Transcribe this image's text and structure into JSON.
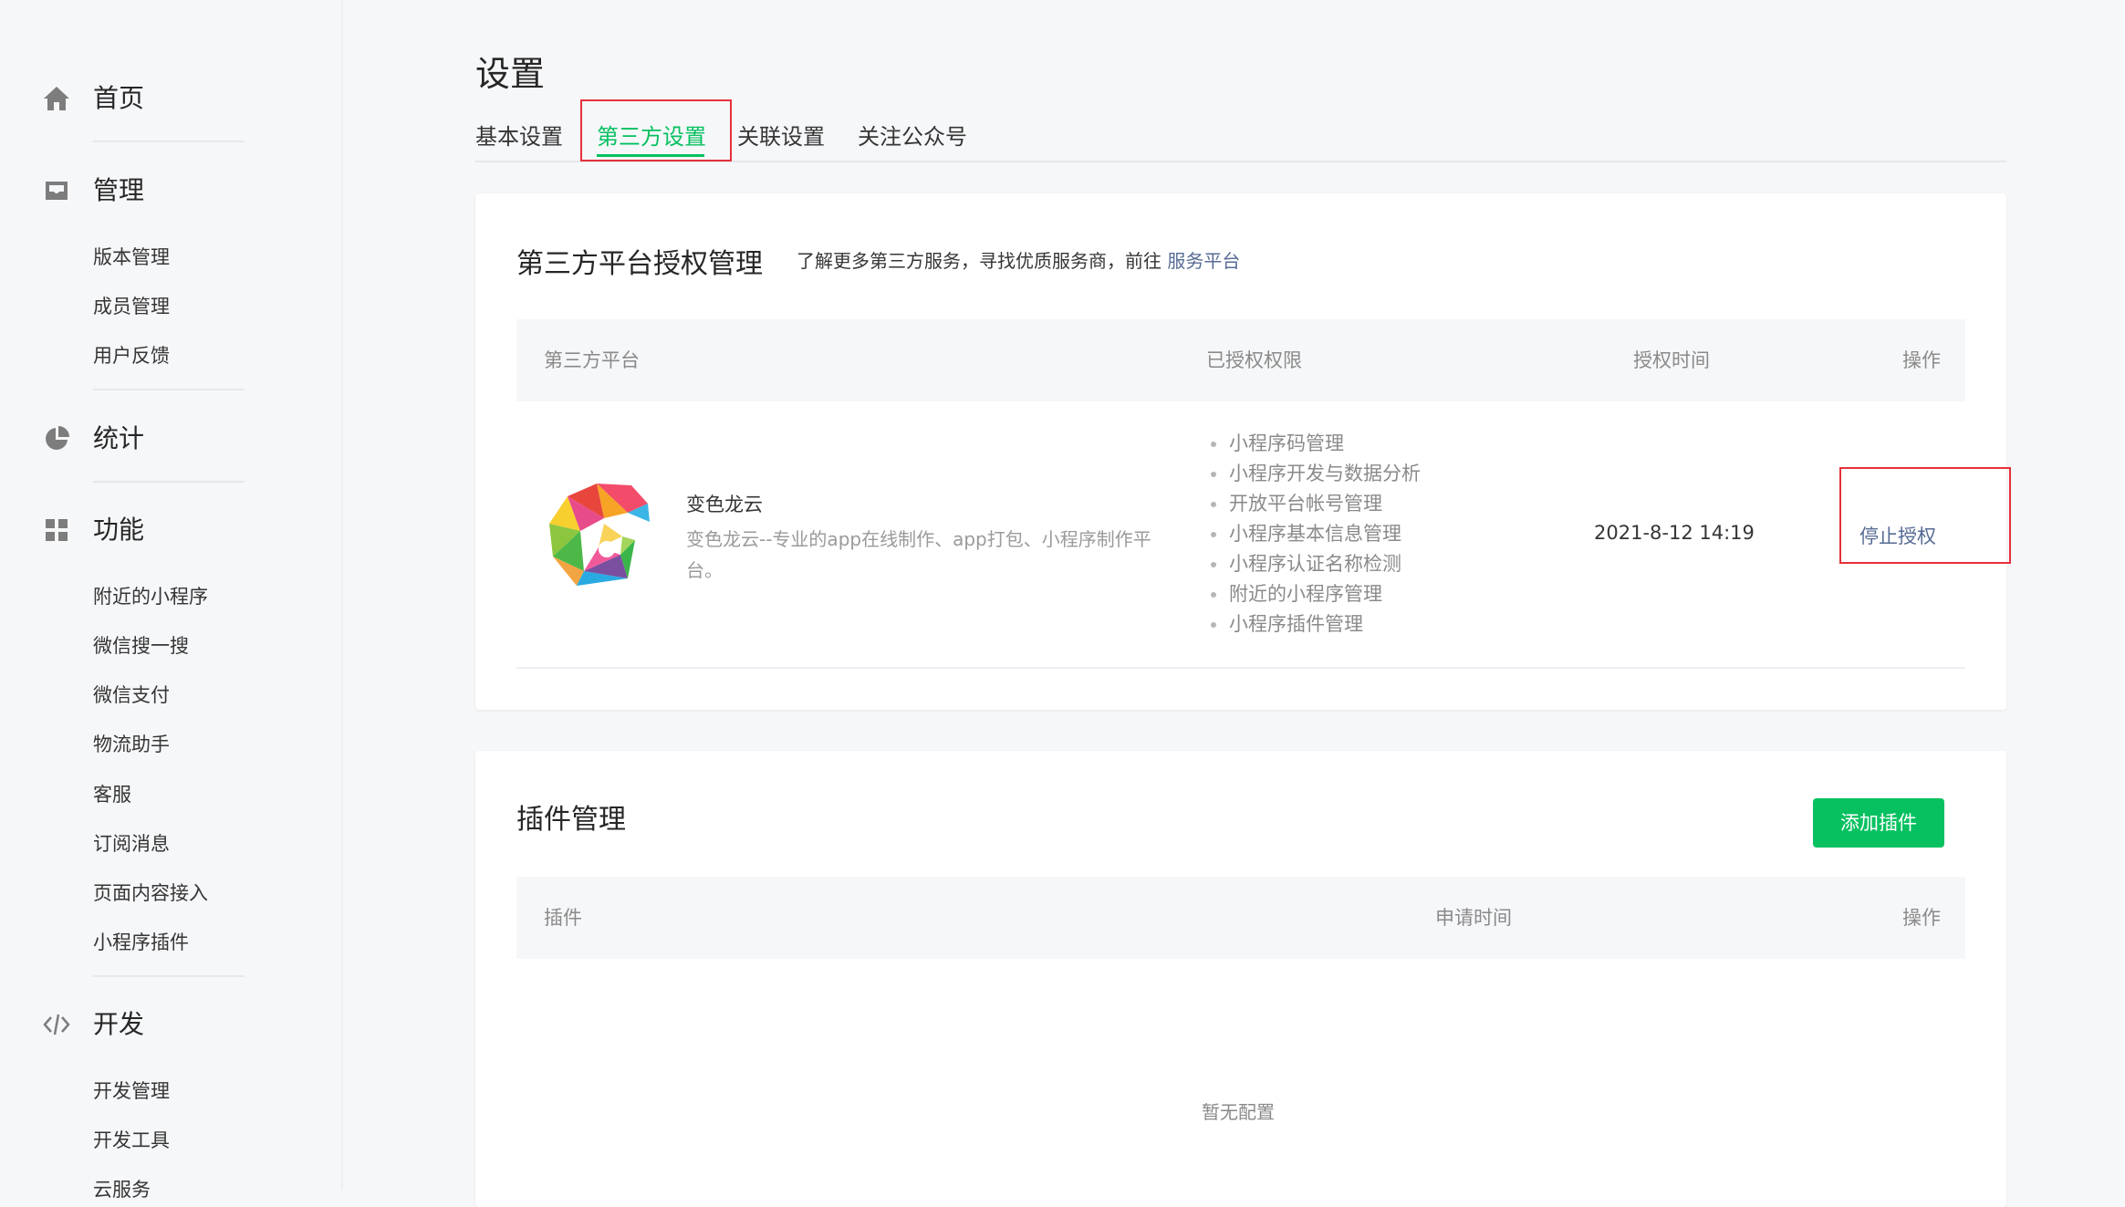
{
  "sidebar": {
    "home": "首页",
    "manage": {
      "label": "管理",
      "items": [
        "版本管理",
        "成员管理",
        "用户反馈"
      ]
    },
    "stats": "统计",
    "features": {
      "label": "功能",
      "items": [
        "附近的小程序",
        "微信搜一搜",
        "微信支付",
        "物流助手",
        "客服",
        "订阅消息",
        "页面内容接入",
        "小程序插件"
      ]
    },
    "dev": {
      "label": "开发",
      "items": [
        "开发管理",
        "开发工具",
        "云服务"
      ]
    }
  },
  "page": {
    "title": "设置",
    "tabs": [
      "基本设置",
      "第三方设置",
      "关联设置",
      "关注公众号"
    ],
    "active_tab": 1
  },
  "third_party": {
    "title": "第三方平台授权管理",
    "desc_prefix": "了解更多第三方服务，寻找优质服务商，前往 ",
    "desc_link": "服务平台",
    "columns": [
      "第三方平台",
      "已授权权限",
      "授权时间",
      "操作"
    ],
    "row": {
      "name": "变色龙云",
      "desc": "变色龙云--专业的app在线制作、app打包、小程序制作平台。",
      "permissions": [
        "小程序码管理",
        "小程序开发与数据分析",
        "开放平台帐号管理",
        "小程序基本信息管理",
        "小程序认证名称检测",
        "附近的小程序管理",
        "小程序插件管理"
      ],
      "time": "2021-8-12 14:19",
      "action": "停止授权"
    }
  },
  "plugins": {
    "title": "插件管理",
    "add_button": "添加插件",
    "columns": [
      "插件",
      "申请时间",
      "操作"
    ],
    "empty": "暂无配置"
  },
  "colors": {
    "accent": "#07c160",
    "link": "#576b95",
    "highlight": "#e5313a"
  }
}
